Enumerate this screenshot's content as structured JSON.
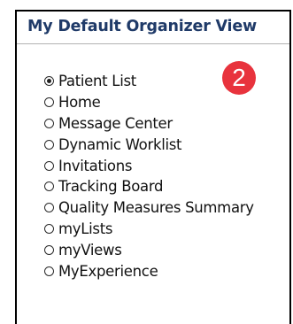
{
  "panel": {
    "title": "My Default Organizer View"
  },
  "options": [
    {
      "label": "Patient List",
      "checked": true
    },
    {
      "label": "Home",
      "checked": false
    },
    {
      "label": "Message Center",
      "checked": false
    },
    {
      "label": "Dynamic Worklist",
      "checked": false
    },
    {
      "label": "Invitations",
      "checked": false
    },
    {
      "label": "Tracking Board",
      "checked": false
    },
    {
      "label": "Quality Measures Summary",
      "checked": false
    },
    {
      "label": "myLists",
      "checked": false
    },
    {
      "label": "myViews",
      "checked": false
    },
    {
      "label": "MyExperience",
      "checked": false
    }
  ],
  "step_badge": {
    "number": "2",
    "color": "#e8333d"
  },
  "colors": {
    "title": "#1f3a68",
    "border": "#000000"
  }
}
